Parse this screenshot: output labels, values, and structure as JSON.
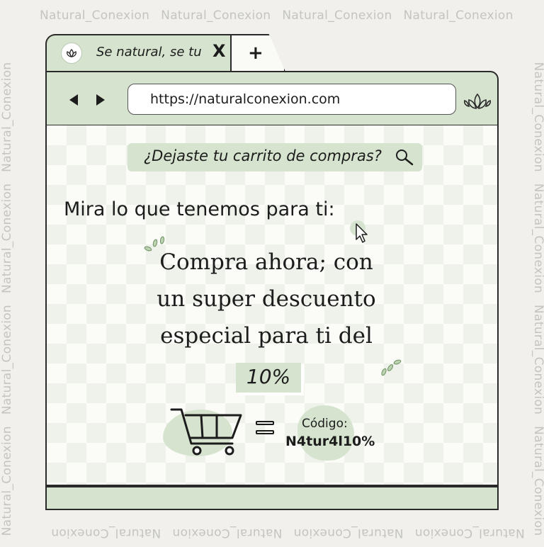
{
  "watermark": {
    "text": "Natural_Conexion"
  },
  "browser": {
    "tab_title": "Se natural, se tu",
    "tab_close": "X",
    "new_tab": "+",
    "url": "https://naturalconexion.com"
  },
  "page": {
    "search_pill": "¿Dejaste tu carrito de compras?",
    "heading": "Mira lo que tenemos para ti:",
    "promo_lines": [
      "Compra ahora; con",
      "un super descuento",
      "especial para ti del"
    ],
    "discount": "10%",
    "code_label": "Código:",
    "code_value": "N4tur4l10%"
  },
  "colors": {
    "accent": "#d6e4cf",
    "outline": "#2a2a2a",
    "background": "#f1f0ec"
  }
}
